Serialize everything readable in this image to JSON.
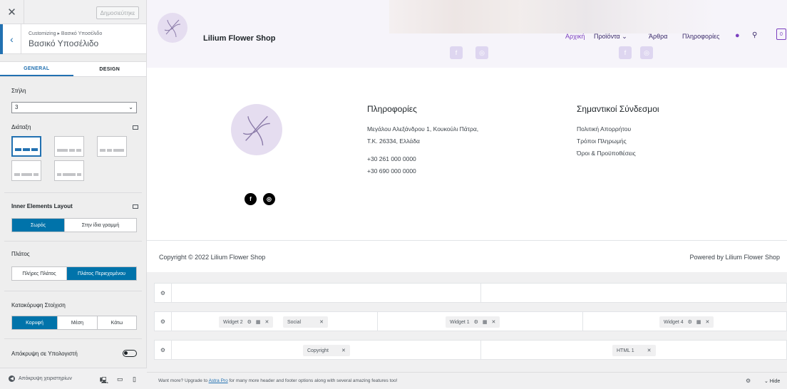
{
  "sidebar": {
    "publish_label": "Δημοσιεύτηκε",
    "breadcrumb": "Customizing ▸ Βασικό Υποσέλιδο",
    "title": "Βασικό Υποσέλιδο",
    "tabs": [
      {
        "label": "GENERAL"
      },
      {
        "label": "DESIGN"
      }
    ],
    "column_label": "Στήλη",
    "column_value": "3",
    "layout_label": "Διάταξη",
    "inner_layout_label": "Inner Elements Layout",
    "inner_layout_options": [
      {
        "label": "Σωρός"
      },
      {
        "label": "Στην ίδια γραμμή"
      }
    ],
    "width_label": "Πλάτος",
    "width_options": [
      {
        "label": "Πλήρες Πλάτος"
      },
      {
        "label": "Πλάτος Περιεχομένου"
      }
    ],
    "valign_label": "Κατακόρυφη Στοίχιση",
    "valign_options": [
      {
        "label": "Κορυφή"
      },
      {
        "label": "Μέση"
      },
      {
        "label": "Κάτω"
      }
    ],
    "hide_desktop_label": "Απόκρυψη σε Υπολογιστή",
    "footer_hide_controls": "Απόκρυψη χειριστηρίων"
  },
  "preview": {
    "brand": "Lilium Flower Shop",
    "nav": [
      {
        "label": "Αρχική"
      },
      {
        "label": "Προϊόντα ⌄"
      },
      {
        "label": "Άρθρα"
      },
      {
        "label": "Πληροφορίες"
      }
    ],
    "cart_count": "0",
    "info_title": "Πληροφορίες",
    "info_lines": [
      {
        "text": "Μεγάλου Αλεξάνδρου 1, Κουκούλι Πάτρα,"
      },
      {
        "text": "Τ.Κ. 26334, Ελλάδα"
      },
      {
        "text": "+30 261 000 0000"
      },
      {
        "text": "+30 690 000 0000"
      }
    ],
    "links_title": "Σημαντικοί Σύνδεσμοι",
    "links": [
      {
        "text": "Πολιτική Απορρήτου"
      },
      {
        "text": "Τρόποι Πληρωμής"
      },
      {
        "text": "Όροι & Προϋποθέσεις"
      }
    ],
    "copyright": "Copyright © 2022 Lilium Flower Shop",
    "powered": "Powered by Lilium Flower Shop"
  },
  "builder": {
    "widget2": "Widget 2",
    "social": "Social",
    "widget1": "Widget 1",
    "widget4": "Widget 4",
    "copyright": "Copyright",
    "html1": "HTML 1"
  },
  "bottombar": {
    "msg_prefix": "Want more? Upgrade to",
    "link": "Astra Pro",
    "msg_suffix": "for many more header and footer options along with several amazing features too!",
    "hide": "⌄ Hide"
  }
}
